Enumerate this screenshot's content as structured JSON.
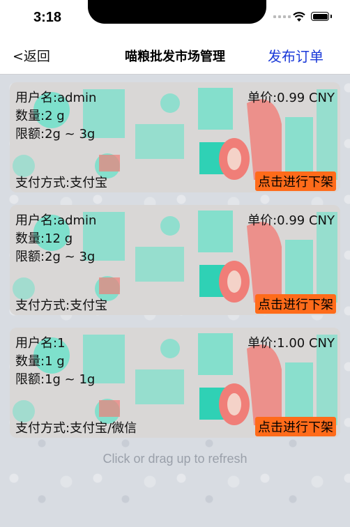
{
  "status_bar": {
    "time": "3:18"
  },
  "nav": {
    "back_label": "<返回",
    "title": "喵粮批发市场管理",
    "publish_label": "发布订单"
  },
  "orders": [
    {
      "username": "用户名:admin",
      "quantity": "数量:2 g",
      "limit": "限额:2g ~ 3g",
      "price": "单价:0.99 CNY",
      "payment": "支付方式:支付宝",
      "action": "点击进行下架"
    },
    {
      "username": "用户名:admin",
      "quantity": "数量:12 g",
      "limit": "限额:2g ~ 3g",
      "price": "单价:0.99 CNY",
      "payment": "支付方式:支付宝",
      "action": "点击进行下架"
    },
    {
      "username": "用户名:1",
      "quantity": "数量:1 g",
      "limit": "限额:1g ~ 1g",
      "price": "单价:1.00 CNY",
      "payment": "支付方式:支付宝/微信",
      "action": "点击进行下架"
    }
  ],
  "refresh_hint": "Click or drag up to refresh",
  "colors": {
    "accent_link": "#1a39d8",
    "action_button": "#ff6b1a",
    "card_teal": "#5fe3c8",
    "card_pink": "#f07e78"
  }
}
